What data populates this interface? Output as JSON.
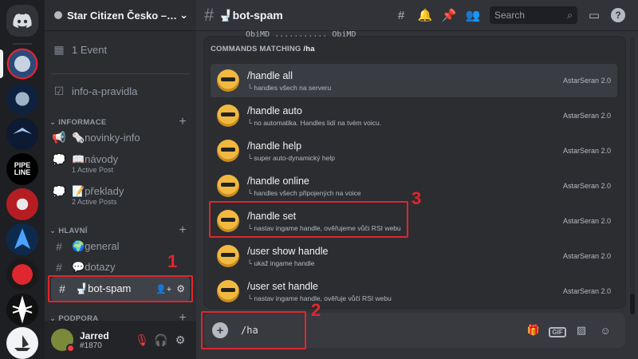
{
  "server": {
    "name": "Star Citizen Česko – S...",
    "event_text": "1 Event"
  },
  "rail_icons": [
    "discord-home-icon",
    "server-icon-sc-cesko",
    "server-icon-sc",
    "server-icon-ravens",
    "server-icon-pipeline",
    "server-icon-red",
    "server-icon-arrow",
    "server-icon-dark",
    "server-icon-white",
    "server-icon-ship"
  ],
  "rail_text": {
    "pipeline": "PIPE\nLINE"
  },
  "channels": {
    "info": "info-a-pravidla",
    "category_info": "INFORMACE",
    "novinky": "🗞️novinky-info",
    "navody": "📖návody",
    "navody_sub": "1 Active Post",
    "preklady": "📝překlady",
    "preklady_sub": "2 Active Posts",
    "category_hlavni": "HLAVNÍ",
    "general": "🌍general",
    "dotazy": "💬dotazy",
    "botspam": "🚽bot-spam",
    "category_podpora": "PODPORA"
  },
  "user": {
    "name": "Jarred",
    "tag": "#1870"
  },
  "topbar": {
    "title": "🚽bot-spam",
    "search_placeholder": "Search"
  },
  "message_line": "ObiMD ........... ObiMD",
  "popup": {
    "header_prefix": "COMMANDS MATCHING",
    "query": "/ha",
    "commands": [
      {
        "name": "/handle all",
        "desc": "└ handles všech na serveru",
        "app": "AstarSeran 2.0"
      },
      {
        "name": "/handle auto",
        "desc": "└ no automatika. Handles lidí na tvém voicu.",
        "app": "AstarSeran 2.0"
      },
      {
        "name": "/handle help",
        "desc": "└ super auto-dynamický help",
        "app": "AstarSeran 2.0"
      },
      {
        "name": "/handle online",
        "desc": "└ handles všech připojených na voice",
        "app": "AstarSeran 2.0"
      },
      {
        "name": "/handle set",
        "desc": "└ nastav ingame handle, ověřujeme vůči RSI webu",
        "app": "AstarSeran 2.0"
      },
      {
        "name": "/user show handle",
        "desc": "└ ukaž ingame handle",
        "app": "AstarSeran 2.0"
      },
      {
        "name": "/user set handle",
        "desc": "└ nastav ingame handle, ověřuje vůči RSI webu",
        "app": "AstarSeran 2.0"
      }
    ]
  },
  "composer": {
    "value": "/ha",
    "gif_label": "GIF"
  },
  "annotations": {
    "one": "1",
    "two": "2",
    "three": "3"
  },
  "colors": {
    "highlight": "#e0262e",
    "accent": "#5865f2"
  }
}
